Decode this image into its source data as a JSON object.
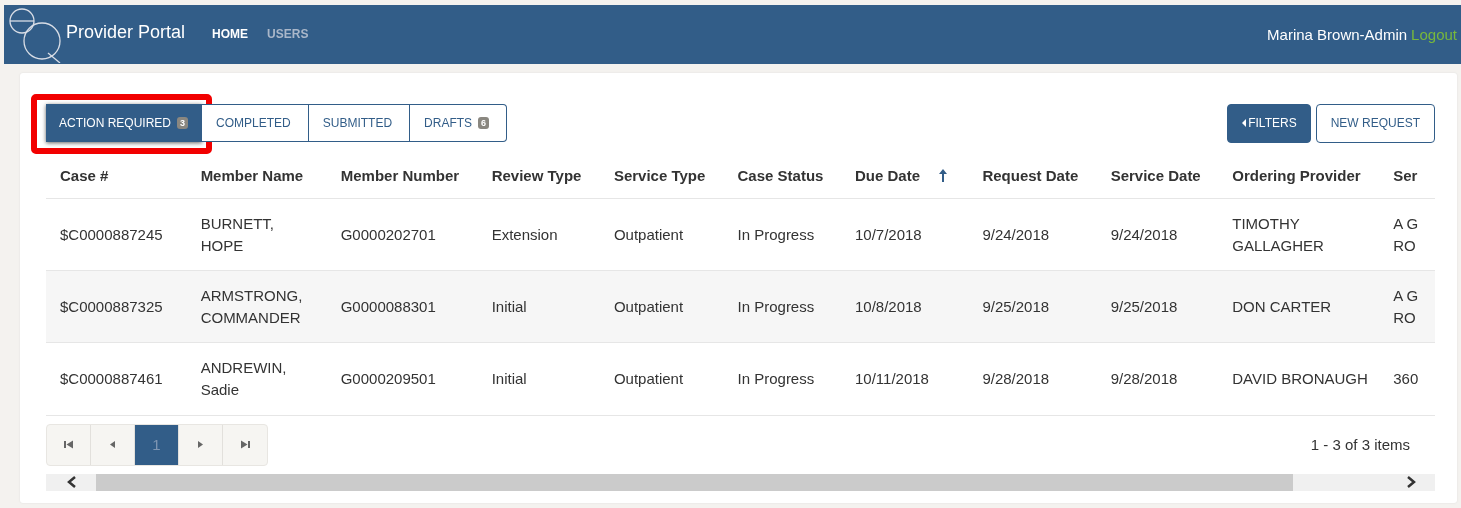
{
  "header": {
    "title": "Provider Portal",
    "nav": [
      {
        "label": "HOME",
        "selected": true
      },
      {
        "label": "USERS",
        "selected": false
      }
    ],
    "user": "Marina Brown-Admin",
    "logout": "Logout"
  },
  "tabs": [
    {
      "label": "ACTION REQUIRED",
      "count": "3",
      "selected": true,
      "highlighted": true
    },
    {
      "label": "COMPLETED",
      "selected": false,
      "highlighted": false
    },
    {
      "label": "SUBMITTED",
      "selected": false,
      "highlighted": false
    },
    {
      "label": "DRAFTS",
      "count": "6",
      "selected": false,
      "highlighted": false
    }
  ],
  "actions": [
    {
      "label": "FILTERS",
      "kind": "primary"
    },
    {
      "label": "NEW REQUEST",
      "kind": "outline"
    }
  ],
  "table": {
    "columns": [
      {
        "label": "Case #",
        "sorted_ascending": false
      },
      {
        "label": "Member Name",
        "sorted_ascending": false
      },
      {
        "label": "Member Number",
        "sorted_ascending": false
      },
      {
        "label": "Review Type",
        "sorted_ascending": false
      },
      {
        "label": "Service Type",
        "sorted_ascending": false
      },
      {
        "label": "Case Status",
        "sorted_ascending": false
      },
      {
        "label": "Due Date",
        "sorted_ascending": true
      },
      {
        "label": "Request Date",
        "sorted_ascending": false
      },
      {
        "label": "Service Date",
        "sorted_ascending": false
      },
      {
        "label": "Ordering Provider",
        "sorted_ascending": false
      },
      {
        "label": "Ser",
        "sorted_ascending": false
      }
    ],
    "rows": [
      [
        "$C0000887245",
        "BURNETT, HOPE",
        "G0000202701",
        "Extension",
        "Outpatient",
        "In Progress",
        "10/7/2018",
        "9/24/2018",
        "9/24/2018",
        "TIMOTHY GALLAGHER",
        "A G RO"
      ],
      [
        "$C0000887325",
        "ARMSTRONG, COMMANDER",
        "G0000088301",
        "Initial",
        "Outpatient",
        "In Progress",
        "10/8/2018",
        "9/25/2018",
        "9/25/2018",
        "DON CARTER",
        "A G RO"
      ],
      [
        "$C0000887461",
        "ANDREWIN, Sadie",
        "G0000209501",
        "Initial",
        "Outpatient",
        "In Progress",
        "10/11/2018",
        "9/28/2018",
        "9/28/2018",
        "DAVID BRONAUGH",
        "360"
      ]
    ]
  },
  "pager": {
    "pages": [
      {
        "label": "1",
        "selected": true
      }
    ],
    "summary": "1 - 3 of 3 items"
  }
}
